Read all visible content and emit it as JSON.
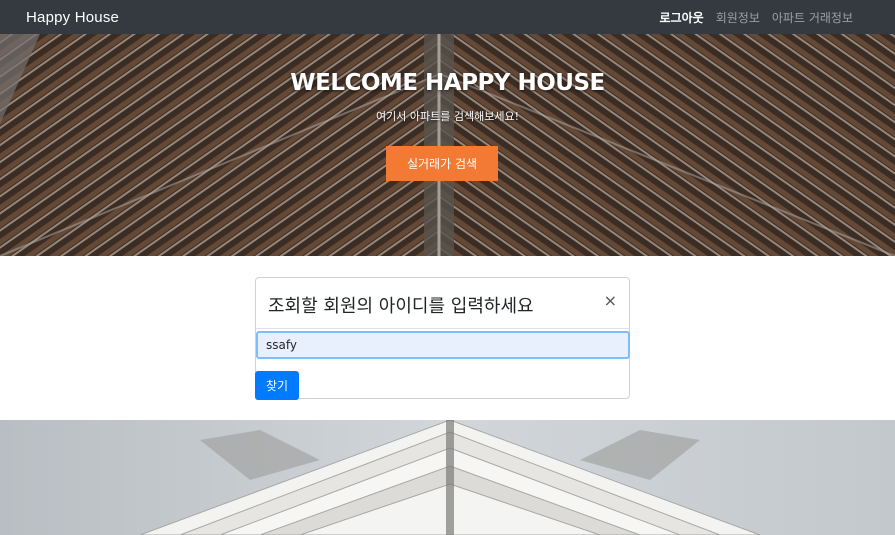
{
  "navbar": {
    "brand": "Happy House",
    "links": [
      {
        "label": "로그아웃",
        "active": true
      },
      {
        "label": "회원정보",
        "active": false
      },
      {
        "label": "아파트 거래정보",
        "active": false
      }
    ]
  },
  "hero": {
    "title": "WELCOME HAPPY HOUSE",
    "subtitle": "여기서 아파트를 검색해보세요!",
    "button_label": "실거래가 검색",
    "button_color": "#f27a35"
  },
  "modal": {
    "title": "조회할 회원의 아이디를 입력하세요",
    "close_symbol": "×",
    "input_value": "ssafy",
    "find_button_label": "찾기",
    "find_button_color": "#007bff"
  },
  "colors": {
    "navbar_bg": "#343a40",
    "input_bg": "#e8f0fe",
    "input_border": "#80bdff"
  }
}
